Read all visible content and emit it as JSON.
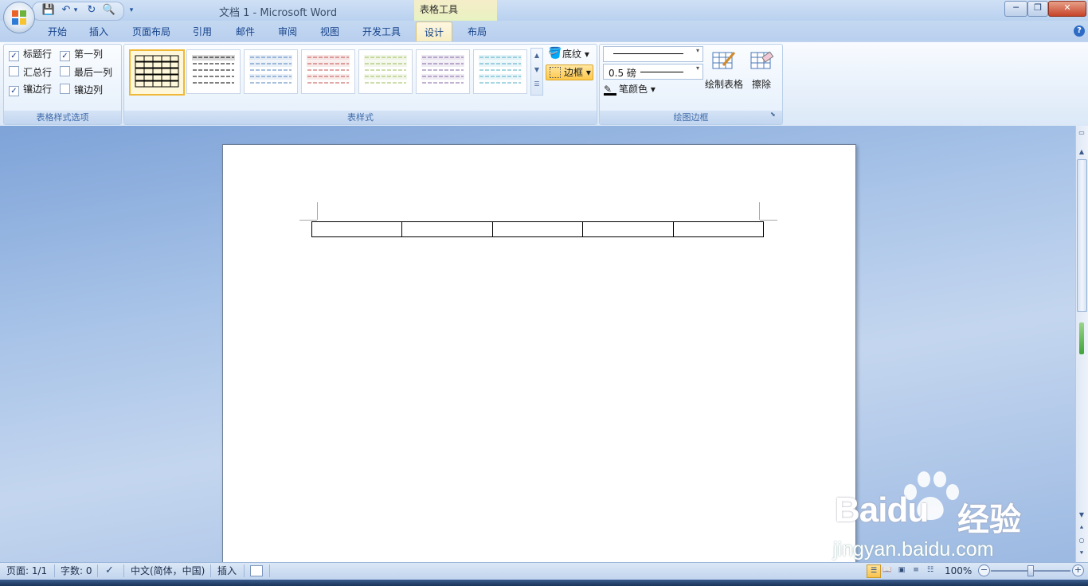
{
  "window": {
    "title": "文档 1 - Microsoft Word",
    "context_tools": "表格工具",
    "minimize": "─",
    "restore": "❐",
    "close": "✕"
  },
  "quick_access": {
    "save": "💾",
    "undo": "↶",
    "redo": "↻",
    "preview": "🔍",
    "customize": "▾"
  },
  "tabs": [
    {
      "label": "开始"
    },
    {
      "label": "插入"
    },
    {
      "label": "页面布局"
    },
    {
      "label": "引用"
    },
    {
      "label": "邮件"
    },
    {
      "label": "审阅"
    },
    {
      "label": "视图"
    },
    {
      "label": "开发工具"
    },
    {
      "label": "设计"
    },
    {
      "label": "布局"
    }
  ],
  "help": "?",
  "table_style_options": {
    "group_label": "表格样式选项",
    "options": [
      {
        "label": "标题行",
        "checked": true
      },
      {
        "label": "第一列",
        "checked": true
      },
      {
        "label": "汇总行",
        "checked": false
      },
      {
        "label": "最后一列",
        "checked": false
      },
      {
        "label": "镶边行",
        "checked": true
      },
      {
        "label": "镶边列",
        "checked": false
      }
    ],
    "check_mark": "✓"
  },
  "table_styles": {
    "group_label": "表样式",
    "swatch_colors": [
      "#000000",
      "#000000",
      "#4f81bd",
      "#c0504d",
      "#9bbb59",
      "#8064a2",
      "#4bacc6"
    ],
    "shading_label": "底纹",
    "borders_label": "边框"
  },
  "draw_borders": {
    "group_label": "绘图边框",
    "pen_weight": "0.5 磅",
    "pen_color_label": "笔颜色",
    "draw_table_label": "绘制表格",
    "eraser_label": "擦除"
  },
  "status": {
    "page": "页面: 1/1",
    "words": "字数: 0",
    "language": "中文(简体，中国)",
    "mode": "插入",
    "zoom": "100%",
    "zoom_minus": "−",
    "zoom_plus": "+"
  },
  "watermark": {
    "brand": "Bai",
    "brand_suffix": "du",
    "jingyan": "经验",
    "url": "jingyan.baidu.com"
  }
}
